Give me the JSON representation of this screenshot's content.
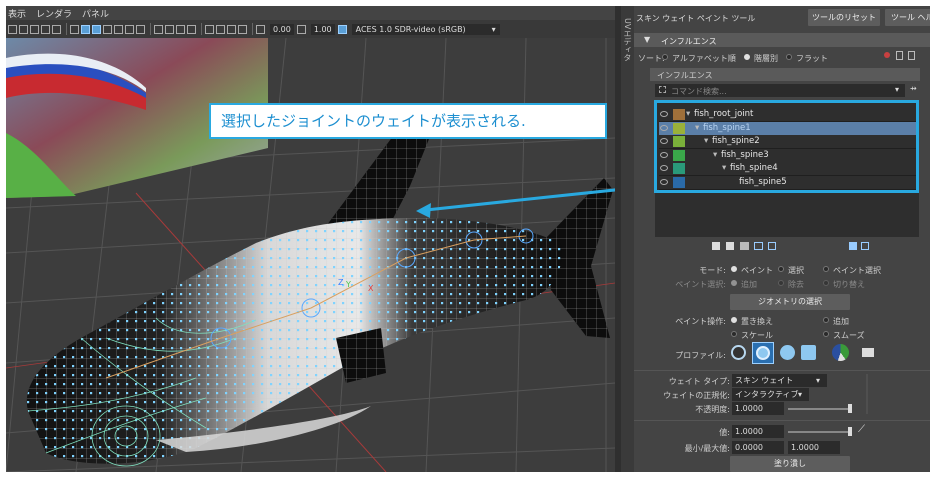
{
  "viewport": {
    "menu": [
      "表示",
      "レンダラ",
      "パネル"
    ],
    "toolbar": {
      "value1": "0.00",
      "value2": "1.00",
      "colorspace": "ACES 1.0 SDR-video (sRGB)"
    }
  },
  "callout": {
    "text": "選択したジョイントのウェイトが表示される."
  },
  "side_tab": {
    "label": "UVエディタ"
  },
  "panel": {
    "title": "スキン ウェイト ペイント ツール",
    "reset_button": "ツールのリセット",
    "help_button": "ツール ヘルプ",
    "section_influence": "インフルエンス",
    "sort": {
      "label": "ソート:",
      "options": [
        "アルファベット順",
        "階層別",
        "フラット"
      ],
      "selected": "階層別"
    },
    "influence_header": "インフルエンス",
    "search_placeholder": "コマンド検索...",
    "joints": [
      {
        "name": "fish_root_joint",
        "indent": 0,
        "color": "#a0703a",
        "expanded": true,
        "selected": false
      },
      {
        "name": "fish_spine1",
        "indent": 1,
        "color": "#9ab13a",
        "expanded": true,
        "selected": true
      },
      {
        "name": "fish_spine2",
        "indent": 2,
        "color": "#7ab03a",
        "expanded": true,
        "selected": false
      },
      {
        "name": "fish_spine3",
        "indent": 3,
        "color": "#3aa84a",
        "expanded": true,
        "selected": false
      },
      {
        "name": "fish_spine4",
        "indent": 4,
        "color": "#2a9a7a",
        "expanded": true,
        "selected": false
      },
      {
        "name": "fish_spine5",
        "indent": 5,
        "color": "#2a6aa8",
        "expanded": false,
        "selected": false
      }
    ],
    "mode": {
      "label": "モード:",
      "options": [
        "ペイント",
        "選択",
        "ペイント選択"
      ],
      "selected": "ペイント"
    },
    "paint_select": {
      "label": "ペイント選択:",
      "options": [
        "追加",
        "除去",
        "切り替え"
      ],
      "selected": "追加"
    },
    "geometry_select_button": "ジオメトリの選択",
    "paint_operation": {
      "label": "ペイント操作:",
      "options": [
        "置き換え",
        "追加",
        "スケール",
        "スムーズ"
      ],
      "selected": "置き換え"
    },
    "profile_label": "プロファイル:",
    "weight_type": {
      "label": "ウェイト タイプ:",
      "value": "スキン ウェイト"
    },
    "normalize": {
      "label": "ウェイトの正規化:",
      "value": "インタラクティブ"
    },
    "opacity": {
      "label": "不透明度:",
      "value": "1.0000",
      "fraction": 1.0
    },
    "value": {
      "label": "値:",
      "value": "1.0000",
      "fraction": 1.0
    },
    "minmax": {
      "label": "最小/最大値:",
      "min": "0.0000",
      "max": "1.0000"
    },
    "flood_button": "塗り潰し"
  },
  "colors": {
    "accent": "#29a9e0",
    "selected_row": "#5b7fa8",
    "panel_bg": "#444444",
    "outliner_bg": "#2e2e2e"
  }
}
